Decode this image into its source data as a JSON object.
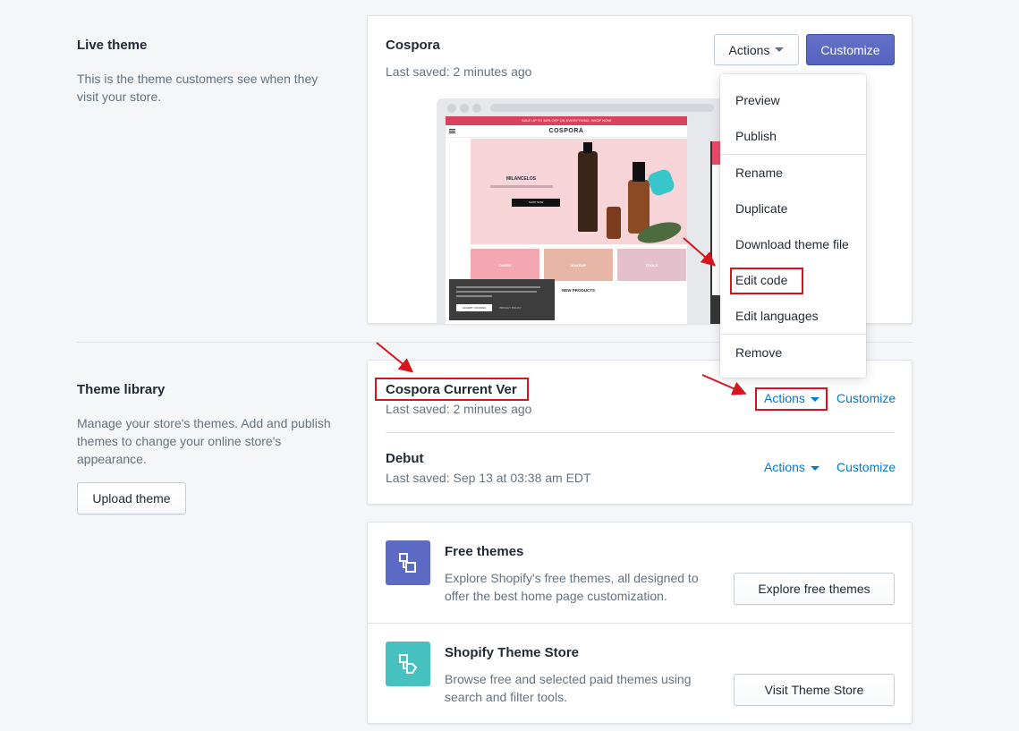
{
  "live_theme": {
    "section_title": "Live theme",
    "section_desc": "This is the theme customers see when they visit your store.",
    "theme_name": "Cospora",
    "last_saved": "Last saved: 2 minutes ago",
    "actions_label": "Actions",
    "customize_label": "Customize",
    "preview": {
      "announcement": "SALE UP TO 50% OFF ON EVERYTHING. SHOP NOW",
      "store_name": "COSPORA",
      "hero_heading": "MILANCELOS",
      "hero_button": "SHOP NOW",
      "tile_1": "CHEEK",
      "tile_2": "MAKEUP",
      "tile_3": "TOOLS",
      "new_products": "NEW PRODUCTS",
      "cookie_accept": "ACCEPT COOKIES",
      "cookie_privacy": "PRIVACY POLICY"
    }
  },
  "actions_menu": {
    "items": [
      "Preview",
      "Publish",
      "Rename",
      "Duplicate",
      "Download theme file",
      "Edit code",
      "Edit languages",
      "Remove"
    ]
  },
  "theme_library": {
    "section_title": "Theme library",
    "section_desc": "Manage your store's themes. Add and publish themes to change your online store's appearance.",
    "upload_label": "Upload theme",
    "themes": [
      {
        "name": "Cospora Current Ver",
        "last_saved": "Last saved: 2 minutes ago",
        "actions": "Actions",
        "customize": "Customize"
      },
      {
        "name": "Debut",
        "last_saved": "Last saved: Sep 13 at 03:38 am EDT",
        "actions": "Actions",
        "customize": "Customize"
      }
    ]
  },
  "free_themes": {
    "title": "Free themes",
    "desc": "Explore Shopify's free themes, all designed to offer the best home page customization.",
    "button": "Explore free themes",
    "icon": "free-themes-icon",
    "icon_color": "#5c6ac4"
  },
  "theme_store": {
    "title": "Shopify Theme Store",
    "desc": "Browse free and selected paid themes using search and filter tools.",
    "button": "Visit Theme Store",
    "icon": "theme-store-icon",
    "icon_color": "#47c1bf"
  },
  "colors": {
    "primary": "#5c6ac4",
    "link": "#007ace",
    "highlight": "#d6141e"
  }
}
